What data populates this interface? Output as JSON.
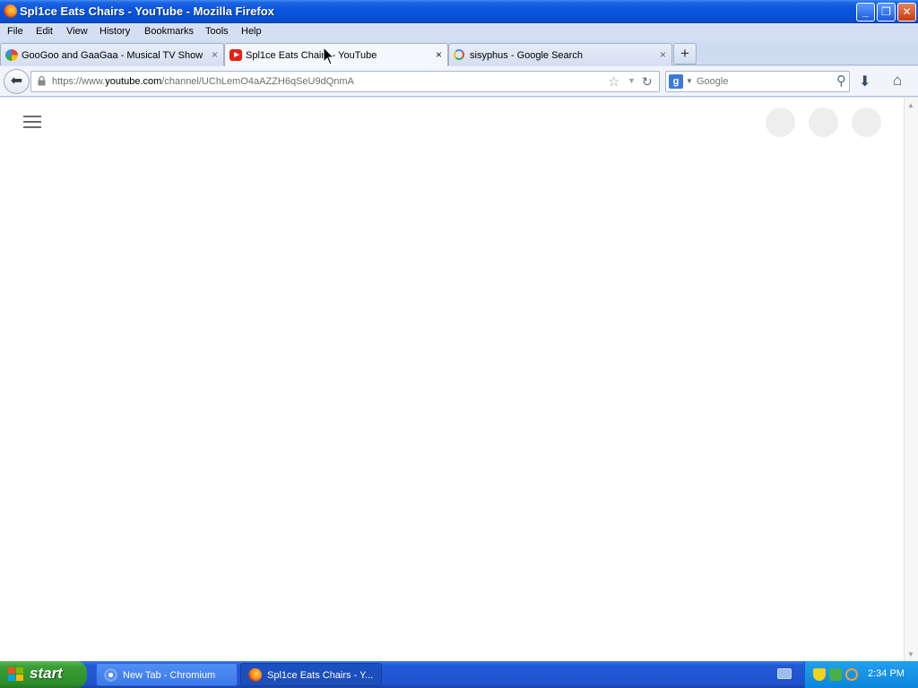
{
  "window": {
    "title": "Spl1ce Eats Chairs - YouTube - Mozilla Firefox",
    "controls": {
      "minimize": "_",
      "maximize": "❐",
      "close": "✕"
    }
  },
  "menu": [
    "File",
    "Edit",
    "View",
    "History",
    "Bookmarks",
    "Tools",
    "Help"
  ],
  "tabs": [
    {
      "label": "GooGoo and GaaGaa - Musical TV Show f...",
      "close": "×",
      "icon": "googoo-favicon-icon"
    },
    {
      "label": "Spl1ce Eats Chairs - YouTube",
      "close": "×",
      "icon": "youtube-favicon-icon",
      "active": true
    },
    {
      "label": "sisyphus - Google Search",
      "close": "×",
      "icon": "google-favicon-icon"
    }
  ],
  "new_tab_label": "+",
  "navbar": {
    "url_prefix": "https://www.",
    "url_domain": "youtube.com",
    "url_path": "/channel/UChLemO4aAZZH6qSeU9dQnmA",
    "search_placeholder": "Google",
    "search_engine_letter": "g"
  },
  "taskbar": {
    "start_label": "start",
    "tasks": [
      {
        "label": "New Tab - Chromium",
        "icon": "chromium-icon"
      },
      {
        "label": "Spl1ce Eats Chairs - Y...",
        "icon": "firefox-icon",
        "active": true
      }
    ],
    "clock": "2:34 PM"
  },
  "colors": {
    "titlebar": "#0a56e0",
    "start_green": "#3a9e35",
    "youtube_red": "#e62117",
    "tray_blue": "#0c86dc"
  }
}
